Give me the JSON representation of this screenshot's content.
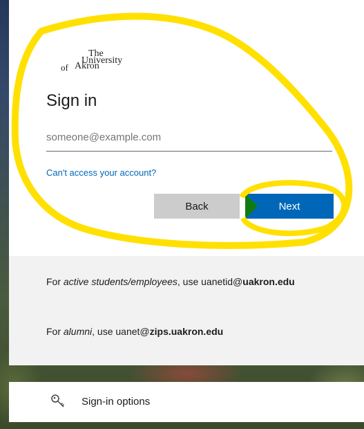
{
  "logo": {
    "line1": "The",
    "line2": "University",
    "line3": "of",
    "line4": "Akron"
  },
  "title": "Sign in",
  "email": {
    "placeholder": "someone@example.com",
    "value": ""
  },
  "help_link": "Can't access your account?",
  "buttons": {
    "back": "Back",
    "next": "Next"
  },
  "hints": {
    "h1_prefix": "For ",
    "h1_em": "active students/employees",
    "h1_mid": ", use uanetid@",
    "h1_strong": "uakron.edu",
    "h2_prefix": "For ",
    "h2_em": "alumni",
    "h2_mid": ", use uanet@",
    "h2_strong": "zips.uakron.edu"
  },
  "options": {
    "label": "Sign-in options",
    "icon": "key-icon"
  },
  "colors": {
    "accent": "#0067b8",
    "highlight": "#ffe000",
    "green": "#107c10"
  }
}
